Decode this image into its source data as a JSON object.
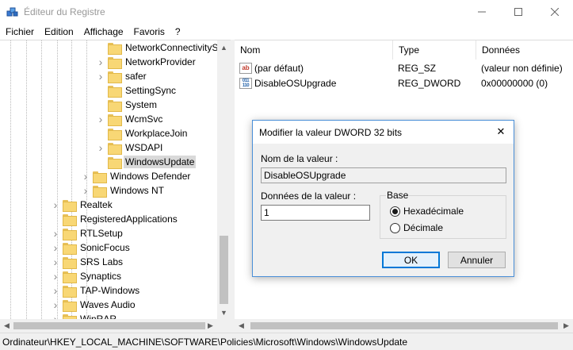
{
  "window": {
    "title": "Éditeur du Registre",
    "min_glyph": "—",
    "max_glyph": "☐",
    "close_glyph": "✕"
  },
  "menu": [
    "Fichier",
    "Edition",
    "Affichage",
    "Favoris",
    "?"
  ],
  "tree": {
    "items": [
      {
        "label": "NetworkConnectivityS",
        "level": 2,
        "expandable": false,
        "selected": false
      },
      {
        "label": "NetworkProvider",
        "level": 2,
        "expandable": true,
        "selected": false
      },
      {
        "label": "safer",
        "level": 2,
        "expandable": true,
        "selected": false
      },
      {
        "label": "SettingSync",
        "level": 2,
        "expandable": false,
        "selected": false
      },
      {
        "label": "System",
        "level": 2,
        "expandable": false,
        "selected": false
      },
      {
        "label": "WcmSvc",
        "level": 2,
        "expandable": true,
        "selected": false
      },
      {
        "label": "WorkplaceJoin",
        "level": 2,
        "expandable": false,
        "selected": false
      },
      {
        "label": "WSDAPI",
        "level": 2,
        "expandable": true,
        "selected": false
      },
      {
        "label": "WindowsUpdate",
        "level": 2,
        "expandable": false,
        "selected": true
      },
      {
        "label": "Windows Defender",
        "level": 1,
        "expandable": true,
        "selected": false
      },
      {
        "label": "Windows NT",
        "level": 1,
        "expandable": true,
        "selected": false
      },
      {
        "label": "Realtek",
        "level": 0,
        "expandable": true,
        "selected": false
      },
      {
        "label": "RegisteredApplications",
        "level": 0,
        "expandable": false,
        "selected": false
      },
      {
        "label": "RTLSetup",
        "level": 0,
        "expandable": true,
        "selected": false
      },
      {
        "label": "SonicFocus",
        "level": 0,
        "expandable": true,
        "selected": false
      },
      {
        "label": "SRS Labs",
        "level": 0,
        "expandable": true,
        "selected": false
      },
      {
        "label": "Synaptics",
        "level": 0,
        "expandable": true,
        "selected": false
      },
      {
        "label": "TAP-Windows",
        "level": 0,
        "expandable": true,
        "selected": false
      },
      {
        "label": "Waves Audio",
        "level": 0,
        "expandable": true,
        "selected": false
      },
      {
        "label": "WinRAR",
        "level": 0,
        "expandable": true,
        "selected": false
      }
    ]
  },
  "list": {
    "columns": [
      "Nom",
      "Type",
      "Données"
    ],
    "rows": [
      {
        "icon": "string-value-icon",
        "icon_text": "ab",
        "name": "(par défaut)",
        "type": "REG_SZ",
        "data": "(valeur non définie)"
      },
      {
        "icon": "binary-value-icon",
        "icon_text": "011\n110",
        "name": "DisableOSUpgrade",
        "type": "REG_DWORD",
        "data": "0x00000000 (0)"
      }
    ]
  },
  "statusbar": {
    "path": "Ordinateur\\HKEY_LOCAL_MACHINE\\SOFTWARE\\Policies\\Microsoft\\Windows\\WindowsUpdate"
  },
  "dialog": {
    "title": "Modifier la valeur DWORD 32 bits",
    "close_glyph": "✕",
    "name_label": "Nom de la valeur :",
    "name_value": "DisableOSUpgrade",
    "data_label": "Données de la valeur :",
    "data_value": "1",
    "base_label": "Base",
    "radio_hex": "Hexadécimale",
    "radio_dec": "Décimale",
    "ok_label": "OK",
    "cancel_label": "Annuler"
  },
  "colors": {
    "accent": "#0078d7",
    "dialog_border": "#4a8fd8",
    "folder": "#f8d775",
    "selection": "#d9d9d9"
  }
}
